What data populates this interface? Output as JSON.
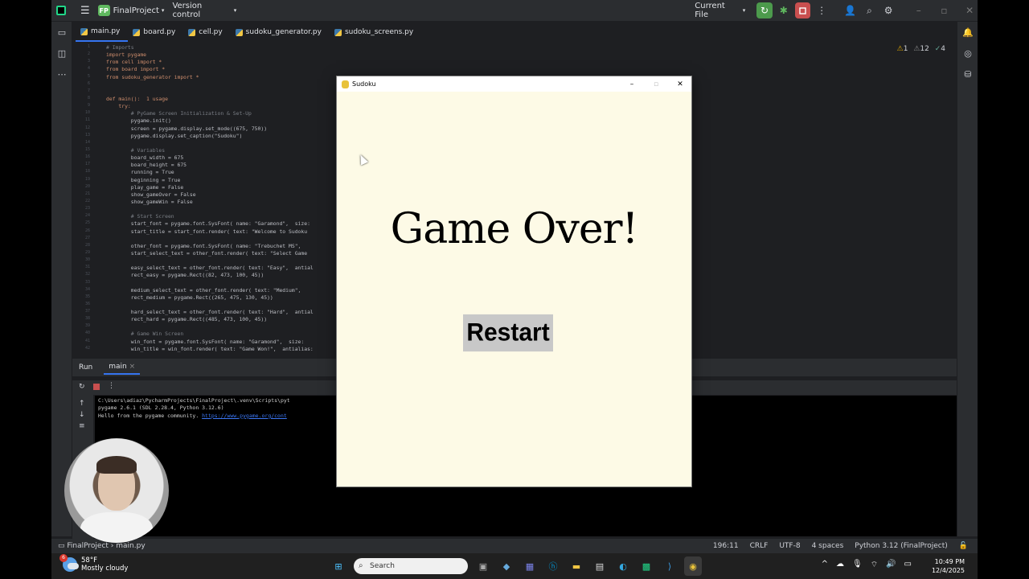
{
  "ide": {
    "project_badge": "FP",
    "project_name": "FinalProject",
    "vcs": "Version control",
    "run_config": "Current File",
    "tabs": [
      {
        "label": "main.py"
      },
      {
        "label": "board.py"
      },
      {
        "label": "cell.py"
      },
      {
        "label": "sudoku_generator.py"
      },
      {
        "label": "sudoku_screens.py"
      }
    ],
    "inspections": {
      "warn": "1",
      "weak": "12",
      "typo": "4"
    },
    "line_numbers": [
      "1",
      "2",
      "3",
      "4",
      "5",
      "6",
      "7",
      "8",
      "9",
      "10",
      "11",
      "12",
      "13",
      "14",
      "15",
      "16",
      "17",
      "18",
      "19",
      "20",
      "21",
      "22",
      "23",
      "24",
      "25",
      "26",
      "27",
      "28",
      "29",
      "30",
      "31",
      "32",
      "33",
      "34",
      "35",
      "36",
      "37",
      "38",
      "39",
      "40",
      "41",
      "42"
    ],
    "code_lines": [
      "# Imports",
      "import pygame",
      "from cell import *",
      "from board import *",
      "from sudoku_generator import *",
      "",
      "",
      "def main():  1 usage",
      "    try:",
      "        # PyGame Screen Initialization & Set-Up",
      "        pygame.init()",
      "        screen = pygame.display.set_mode((675, 750))",
      "        pygame.display.set_caption(\"Sudoku\")",
      "",
      "        # Variables",
      "        board_width = 675",
      "        board_height = 675",
      "        running = True",
      "        beginning = True",
      "        play_game = False",
      "        show_gameOver = False",
      "        show_gameWin = False",
      "",
      "        # Start Screen",
      "        start_font = pygame.font.SysFont( name: \"Garamond\",  size:",
      "        start_title = start_font.render( text: \"Welcome to Sudoku",
      "",
      "        other_font = pygame.font.SysFont( name: \"Trebuchet MS\",",
      "        start_select_text = other_font.render( text: \"Select Game",
      "",
      "        easy_select_text = other_font.render( text: \"Easy\",  antial",
      "        rect_easy = pygame.Rect((82, 473, 100, 45))",
      "",
      "        medium_select_text = other_font.render( text: \"Medium\",",
      "        rect_medium = pygame.Rect((265, 475, 130, 45))",
      "",
      "        hard_select_text = other_font.render( text: \"Hard\",  antial",
      "        rect_hard = pygame.Rect((485, 473, 100, 45))",
      "",
      "        # Game Win Screen",
      "        win_font = pygame.font.SysFont( name: \"Garamond\",  size:",
      "        win_title = win_font.render( text: \"Game Won!\",  antialias:"
    ],
    "run_label": "Run",
    "run_tab": "main",
    "console": [
      "C:\\Users\\adiaz\\PycharmProjects\\FinalProject\\.venv\\Scripts\\pyt",
      "pygame 2.6.1 (SDL 2.28.4, Python 3.12.6)",
      "Hello from the pygame community. "
    ],
    "console_link": "https://www.pygame.org/cont",
    "status": {
      "project": "FinalProject",
      "file": "main.py",
      "pos": "196:11",
      "eol": "CRLF",
      "enc": "UTF-8",
      "indent": "4 spaces",
      "interp": "Python 3.12 (FinalProject)"
    }
  },
  "game": {
    "window_title": "Sudoku",
    "heading": "Game Over!",
    "restart_label": "Restart"
  },
  "taskbar": {
    "temp": "58°F",
    "weather": "Mostly cloudy",
    "weather_badge": "6",
    "search_placeholder": "Search",
    "time": "10:49 PM",
    "date": "12/4/2025"
  },
  "colors": {
    "game_bg": "#fdfae6",
    "restart_bg": "#c8c8c8",
    "accent": "#3574f0"
  }
}
